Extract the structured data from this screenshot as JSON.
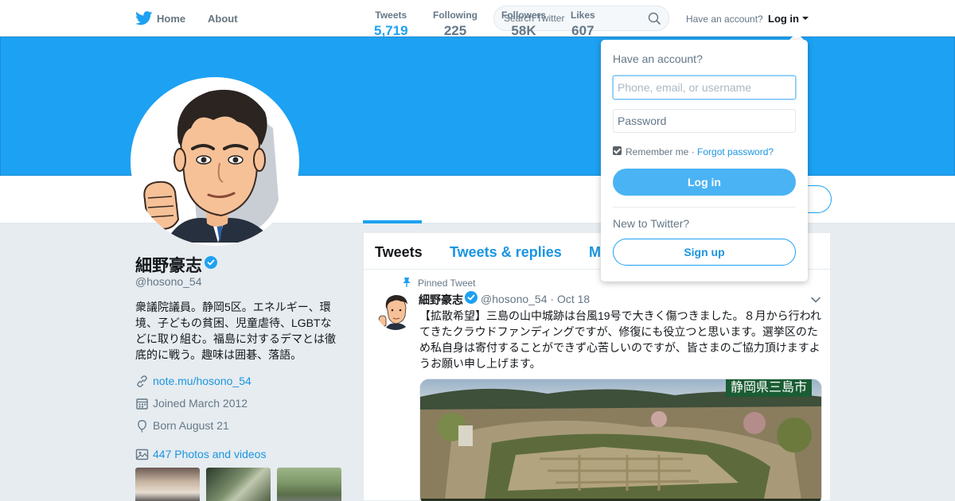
{
  "nav": {
    "home_label": "Home",
    "about_label": "About",
    "search_placeholder": "Search Twitter",
    "have_account": "Have an account?",
    "login_label": "Log in"
  },
  "colors": {
    "brand": "#1da1f2",
    "link": "#1b95e0",
    "background": "#e6ecf0"
  },
  "profile": {
    "name": "細野豪志",
    "handle": "@hosono_54",
    "bio": "衆議院議員。静岡5区。エネルギー、環境、子どもの貧困、児童虐待、LGBTなどに取り組む。福島に対するデマとは徹底的に戦う。趣味は囲碁、落語。",
    "website": "note.mu/hosono_54",
    "joined": "Joined March 2012",
    "born": "Born August 21",
    "photos_link": "447 Photos and videos",
    "verified": true
  },
  "stats": [
    {
      "label": "Tweets",
      "value": "5,719",
      "active": true
    },
    {
      "label": "Following",
      "value": "225",
      "active": false
    },
    {
      "label": "Followers",
      "value": "58K",
      "active": false
    },
    {
      "label": "Likes",
      "value": "607",
      "active": false
    }
  ],
  "timeline": {
    "tabs": [
      "Tweets",
      "Tweets & replies",
      "M"
    ],
    "pinned_label": "Pinned Tweet",
    "tweet": {
      "name": "細野豪志",
      "handle": "@hosono_54",
      "date": "Oct 18",
      "text": "【拡散希望】三島の山中城跡は台風19号で大きく傷つきました。８月から行われてきたクラウドファンディングですが、修復にも役立つと思います。選挙区のため私自身は寄付することができず心苦しいのですが、皆さまのご協力頂けますようお願い申し上げます。",
      "media_caption": "静岡県三島市"
    }
  },
  "login_dropdown": {
    "title": "Have an account?",
    "username_placeholder": "Phone, email, or username",
    "password_placeholder": "Password",
    "remember_me": "Remember me",
    "separator": " · ",
    "forgot_password": "Forgot password?",
    "login_button": "Log in",
    "new_to_twitter": "New to Twitter?",
    "signup_button": "Sign up"
  }
}
